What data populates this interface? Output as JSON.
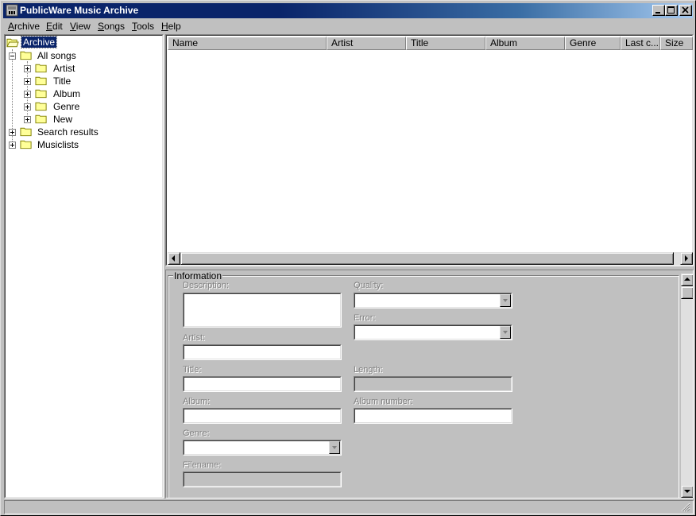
{
  "window": {
    "title": "PublicWare Music Archive",
    "controls": [
      "minimize-icon",
      "maximize-icon",
      "close-icon"
    ]
  },
  "menu": [
    {
      "label": "Archive",
      "mnemonic": "A",
      "rest": "rchive"
    },
    {
      "label": "Edit",
      "mnemonic": "E",
      "rest": "dit"
    },
    {
      "label": "View",
      "mnemonic": "V",
      "rest": "iew"
    },
    {
      "label": "Songs",
      "mnemonic": "S",
      "rest": "ongs"
    },
    {
      "label": "Tools",
      "mnemonic": "T",
      "rest": "ools"
    },
    {
      "label": "Help",
      "mnemonic": "H",
      "rest": "elp"
    }
  ],
  "tree": {
    "root": "Archive",
    "all_songs": "All songs",
    "children": [
      "Artist",
      "Title",
      "Album",
      "Genre",
      "New"
    ],
    "search_results": "Search results",
    "musiclists": "Musiclists"
  },
  "list": {
    "columns": [
      "Name",
      "Artist",
      "Title",
      "Album",
      "Genre",
      "Last c...",
      "Size"
    ]
  },
  "info": {
    "legend": "Information",
    "description_label": "Description:",
    "artist_label": "Artist:",
    "title_label": "Title:",
    "album_label": "Album:",
    "genre_label": "Genre:",
    "filename_label": "Filename:",
    "quality_label": "Quality:",
    "error_label": "Error:",
    "length_label": "Length:",
    "album_number_label": "Album number:",
    "description_value": "",
    "artist_value": "",
    "title_value": "",
    "album_value": "",
    "genre_value": "",
    "filename_value": "",
    "quality_value": "",
    "error_value": "",
    "length_value": "",
    "album_number_value": ""
  },
  "status": {
    "text": ""
  },
  "colors": {
    "titlebar": "#0a246a",
    "face": "#c0c0c0",
    "selection": "#0a246a"
  }
}
